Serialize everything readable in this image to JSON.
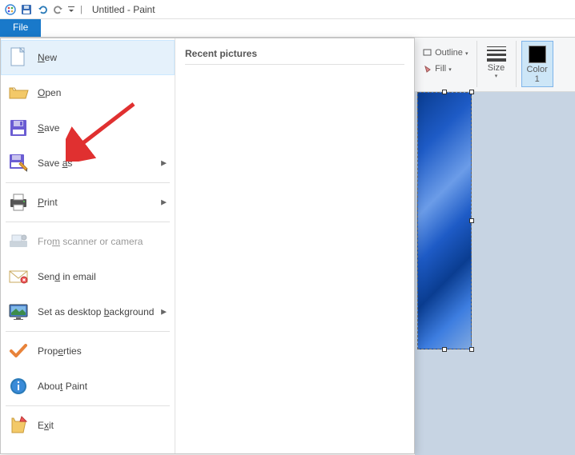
{
  "title": "Untitled - Paint",
  "file_tab": "File",
  "menu": {
    "new": "New",
    "open": "Open",
    "save": "Save",
    "save_as": "Save as",
    "print": "Print",
    "scanner": "From scanner or camera",
    "email": "Send in email",
    "desktop": "Set as desktop background",
    "properties": "Properties",
    "about": "About Paint",
    "exit": "Exit"
  },
  "recent_header": "Recent pictures",
  "ribbon": {
    "outline": "Outline",
    "fill": "Fill",
    "size": "Size",
    "color1": "Color\n1"
  }
}
